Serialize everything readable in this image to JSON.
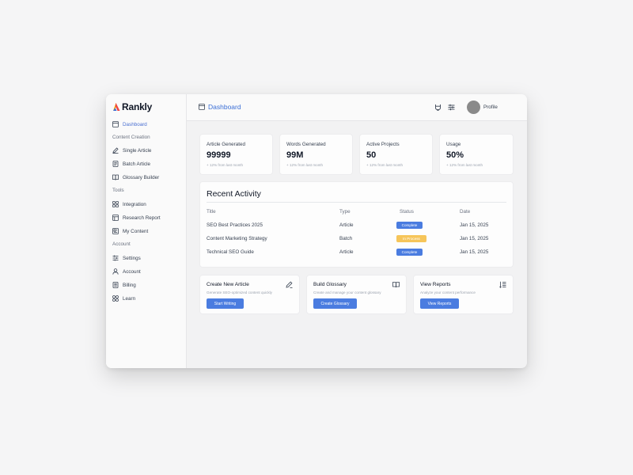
{
  "app": {
    "name": "Rankly",
    "accent": "#4a7ce0"
  },
  "sidebar": {
    "items": [
      {
        "label": "Dashboard",
        "icon": "dashboard-icon",
        "active": true
      },
      {
        "section": "Content Creation"
      },
      {
        "label": "Single Article",
        "icon": "pen-icon"
      },
      {
        "label": "Batch Article",
        "icon": "document-icon"
      },
      {
        "label": "Glossary Builder",
        "icon": "book-icon"
      },
      {
        "section": "Tools"
      },
      {
        "label": "Integration",
        "icon": "grid-icon"
      },
      {
        "label": "Research Report",
        "icon": "report-icon"
      },
      {
        "label": "My Content",
        "icon": "content-icon"
      },
      {
        "section": "Account"
      },
      {
        "label": "Settings",
        "icon": "sliders-icon"
      },
      {
        "label": "Account",
        "icon": "user-icon"
      },
      {
        "label": "Billing",
        "icon": "billing-icon"
      },
      {
        "label": "Learn",
        "icon": "learn-icon"
      }
    ]
  },
  "header": {
    "title": "Dashboard",
    "profile_label": "Profile"
  },
  "stats": [
    {
      "label": "Article Generated",
      "value": "99999",
      "change": "+ 12% from last month"
    },
    {
      "label": "Words Generated",
      "value": "99M",
      "change": "+ 12% from last month"
    },
    {
      "label": "Active Projects",
      "value": "50",
      "change": "+ 12% from last month"
    },
    {
      "label": "Usage",
      "value": "50%",
      "change": "+ 12% from last month"
    }
  ],
  "activity": {
    "title": "Recent Activity",
    "columns": [
      "Title",
      "Type",
      "Status",
      "Date"
    ],
    "rows": [
      {
        "title": "SEO Best Practices 2025",
        "type": "Article",
        "status": "Complete",
        "date": "Jan 15, 2025"
      },
      {
        "title": "Content Marketing Strategy",
        "type": "Batch",
        "status": "In Process",
        "date": "Jan 15, 2025"
      },
      {
        "title": "Technical SEO Guide",
        "type": "Article",
        "status": "Complete",
        "date": "Jan 15, 2025"
      }
    ]
  },
  "actions": [
    {
      "title": "Create New Article",
      "description": "Generate SEO-optimized content quickly",
      "button": "Start Writing",
      "icon": "pen-icon"
    },
    {
      "title": "Build Glossary",
      "description": "Create and manage your content glossary",
      "button": "Create Glossary",
      "icon": "book-open-icon"
    },
    {
      "title": "View Reports",
      "description": "Analyze your content performance",
      "button": "View Reports",
      "icon": "list-sort-icon"
    }
  ]
}
